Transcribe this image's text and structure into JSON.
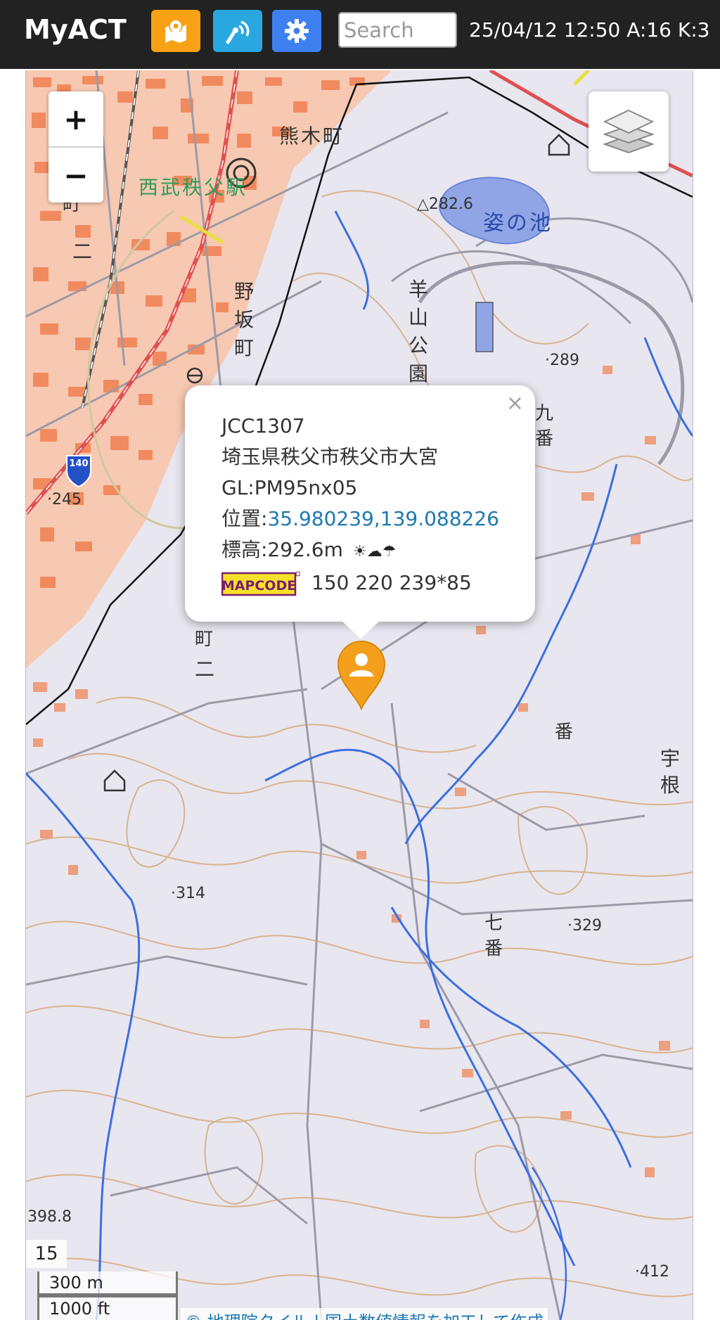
{
  "app": {
    "title": "MyACT",
    "status": "25/04/12 12:50 A:16 K:3"
  },
  "toolbar": {
    "map_button_icon": "map-pin-icon",
    "radio_button_icon": "signal-icon",
    "settings_button_icon": "gear-icon",
    "search_placeholder": "Search",
    "search_value": ""
  },
  "map": {
    "zoom_in_label": "+",
    "zoom_out_label": "−",
    "zoom_level": "15",
    "scale_metric": "300 m",
    "scale_imperial": "1000 ft",
    "attribution": "© 地理院タイル | 国土数値情報を加工して作成",
    "labels": {
      "station": "西武秩父駅",
      "kumaki": "熊木町",
      "pond": "姿の池",
      "nosaka_1": "野",
      "nosaka_2": "坂",
      "nosaka_3": "町",
      "park_1": "羊",
      "park_2": "山",
      "park_3": "公",
      "park_4": "園",
      "kyuban_1": "九",
      "kyuban_2": "番",
      "nanaban_1": "七",
      "nanaban_2": "番",
      "ban": "番",
      "une_1": "宇",
      "une_2": "根",
      "machi": "町",
      "machi2": "町",
      "ni": "二",
      "ni2": "二",
      "route": "140",
      "elev_282": "△282.6",
      "elev_289": "·289",
      "elev_245": "·245",
      "elev_314": "·314",
      "elev_329": "·329",
      "elev_412": "·412",
      "elev_398": "398.8"
    },
    "colors": {
      "background": "#e8e6ef",
      "urban": "#f08050",
      "contour": "#d4a878",
      "road": "#9c9aa8",
      "river": "#3b6fe0",
      "rail": "#e05050",
      "boundary": "#111111",
      "pond": "#8fa5e6",
      "marker": "#f5a01c"
    }
  },
  "popup": {
    "close_label": "×",
    "call": "JCC1307",
    "address": "埼玉県秩父市秩父市大宮",
    "grid": "GL:PM95nx05",
    "position_label": "位置:",
    "position_value": "35.980239,139.088226",
    "elevation": "標高:292.6m",
    "weather_icons": "☀☁☂",
    "mapcode_logo_text": "MAPCODE",
    "mapcode": "150 220 239*85"
  }
}
